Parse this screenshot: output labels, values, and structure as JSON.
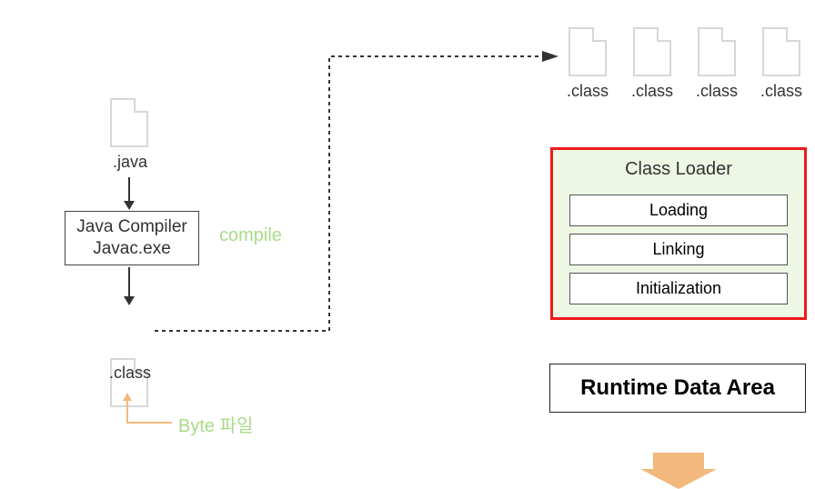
{
  "left": {
    "javaFile": ".java",
    "compilerLine1": "Java Compiler",
    "compilerLine2": "Javac.exe",
    "compileLabel": "compile",
    "classFile": ".class",
    "byteLabel": "Byte 파일"
  },
  "topClassFiles": {
    "label": ".class",
    "count": 4
  },
  "classLoader": {
    "title": "Class Loader",
    "steps": [
      "Loading",
      "Linking",
      "Initialization"
    ]
  },
  "runtime": "Runtime Data Area"
}
